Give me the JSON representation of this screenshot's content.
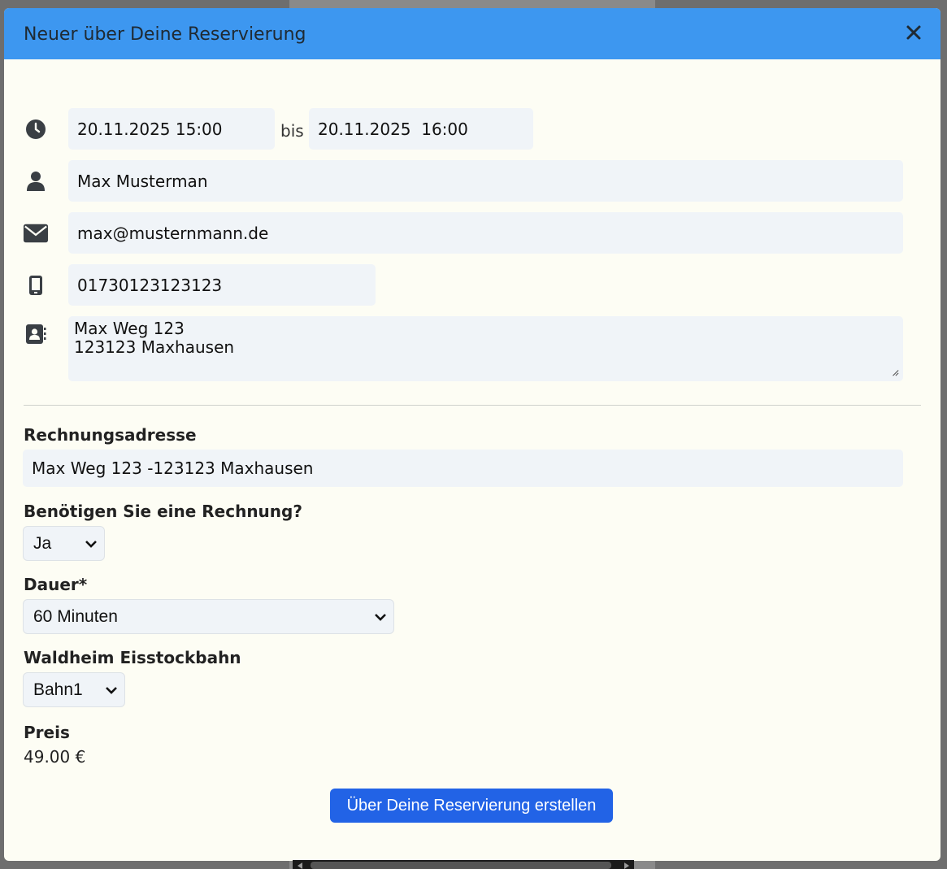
{
  "modal": {
    "title": "Neuer über Deine Reservierung"
  },
  "reservation": {
    "start": "20.11.2025 15:00",
    "separator": "bis",
    "end": "20.11.2025  16:00",
    "name": "Max Musterman",
    "email": "max@musternmann.de",
    "phone": "01730123123123",
    "address": "Max Weg 123\n123123 Maxhausen"
  },
  "billing": {
    "label": "Rechnungsadresse",
    "value": "Max Weg 123 -123123 Maxhausen"
  },
  "invoice": {
    "label": "Benötigen Sie eine Rechnung?",
    "selected": "Ja"
  },
  "duration": {
    "label": "Dauer*",
    "selected": "60 Minuten"
  },
  "lane": {
    "label": "Waldheim Eisstockbahn",
    "selected": "Bahn1"
  },
  "price": {
    "label": "Preis",
    "value": "49.00 €"
  },
  "submit": {
    "label": "Über Deine Reservierung erstellen"
  },
  "colors": {
    "header": "#3d97f0",
    "modal_bg": "#fdfdf4",
    "field_bg": "#f0f4f8",
    "button": "#2263e6"
  },
  "icons": [
    "clock-icon",
    "user-icon",
    "envelope-icon",
    "mobile-icon",
    "address-book-icon",
    "close-icon",
    "chevron-down-icon"
  ]
}
